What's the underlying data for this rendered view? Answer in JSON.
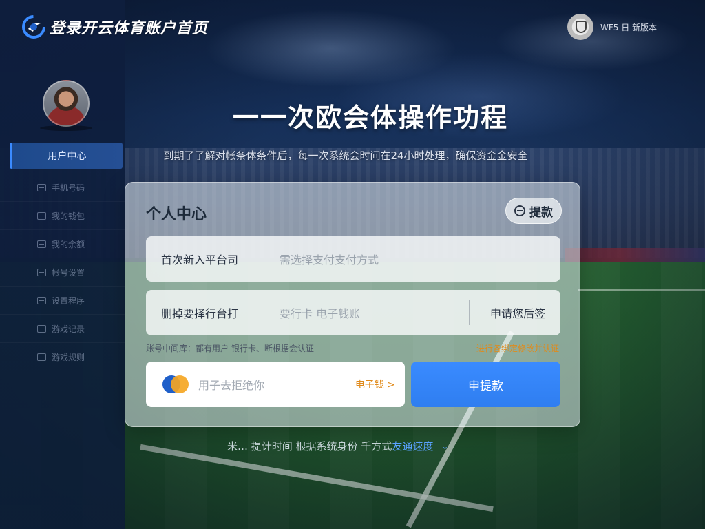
{
  "brand": {
    "title": "登录开云体育账户首页"
  },
  "top_right": {
    "label": "WF5 日 新版本"
  },
  "sidebar": {
    "active_item": "用户中心",
    "items": [
      {
        "label": "手机号码",
        "icon": "square-icon"
      },
      {
        "label": "我的钱包",
        "icon": "square-icon"
      },
      {
        "label": "我的余额",
        "icon": "square-icon"
      },
      {
        "label": "帐号设置",
        "icon": "square-icon"
      },
      {
        "label": "设置程序",
        "icon": "square-icon"
      },
      {
        "label": "游戏记录",
        "icon": "square-icon"
      },
      {
        "label": "游戏规则",
        "icon": "square-icon"
      }
    ]
  },
  "hero": {
    "title": "一一次欧会体操作功程",
    "subtitle": "到期了了解对帐条体条件后，每一次系统会时间在24小时处理，确保资金金安全"
  },
  "card": {
    "title": "个人中心",
    "withdraw_label": "提款",
    "field1": {
      "label": "首次新入平台司",
      "placeholder": "需选择支付支付方式"
    },
    "field2": {
      "label": "删掉要择行台打",
      "placeholder": "要行卡 电子钱账",
      "action": "申请您后签"
    },
    "hint_left": "账号中间库：都有用户 银行卡、断根据会认证",
    "hint_right": "进行各绑定修改并认证",
    "pay": {
      "placeholder": "用子去拒绝你",
      "link": "电子钱 >"
    },
    "apply_label": "申提款"
  },
  "footer": {
    "text": "米… 提计时间 根据系统身份 千方式 ",
    "link": "友通速度",
    "chevron": "chevron-down-icon"
  },
  "colors": {
    "accent_blue": "#2f7ef0",
    "link_orange": "#e08a1a",
    "sidebar_active": "#1e4a8c"
  }
}
